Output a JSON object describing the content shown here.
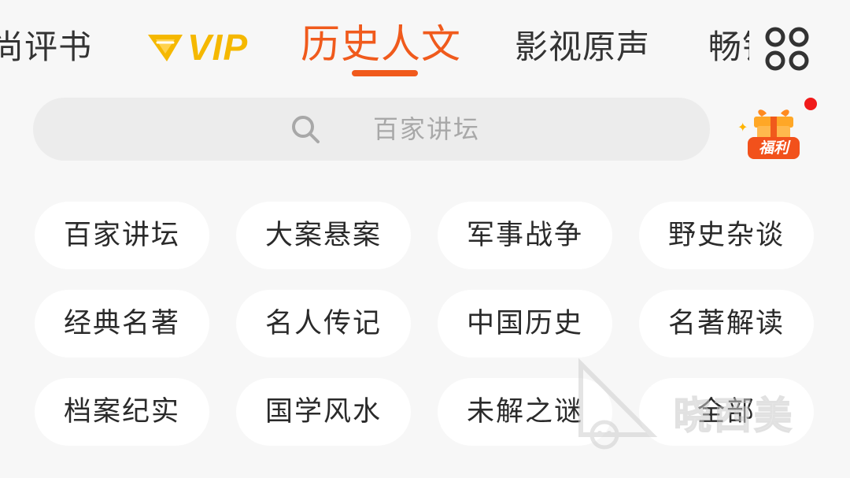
{
  "tabs": [
    {
      "label": "尚评书",
      "active": false
    },
    {
      "label": "VIP",
      "active": false,
      "icon": "vip-crown-icon",
      "color": "#f5b800"
    },
    {
      "label": "历史人文",
      "active": true,
      "color": "#f05a1c"
    },
    {
      "label": "影视原声",
      "active": false
    },
    {
      "label": "畅销",
      "active": false
    }
  ],
  "more_icon": "four-dots-grid-icon",
  "search": {
    "placeholder": "百家讲坛",
    "icon": "search-icon"
  },
  "gift": {
    "label": "福利",
    "icon": "gift-box-icon",
    "has_notification_dot": true
  },
  "categories": [
    {
      "label": "百家讲坛"
    },
    {
      "label": "大案悬案"
    },
    {
      "label": "军事战争"
    },
    {
      "label": "野史杂谈"
    },
    {
      "label": "经典名著"
    },
    {
      "label": "名人传记"
    },
    {
      "label": "中国历史"
    },
    {
      "label": "名著解读"
    },
    {
      "label": "档案纪实"
    },
    {
      "label": "国学风水"
    },
    {
      "label": "未解之谜"
    },
    {
      "label": "全部"
    }
  ],
  "watermark": {
    "text": "晓西美"
  },
  "colors": {
    "accent": "#f05a1c",
    "vip": "#f5b800",
    "text": "#2a2a2a",
    "background": "#f7f7f7"
  }
}
